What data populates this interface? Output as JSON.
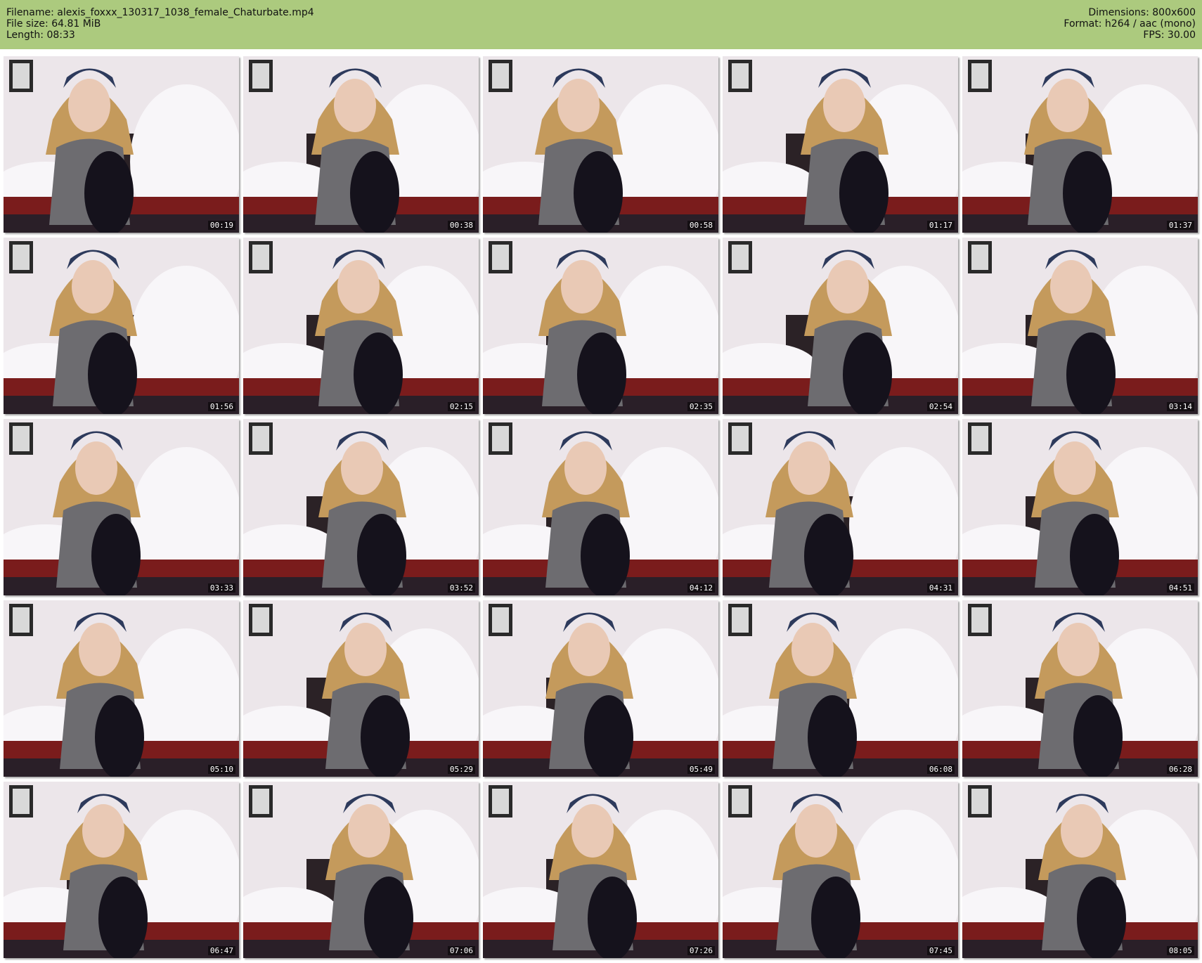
{
  "header": {
    "filename": "Filename: alexis_foxxx_130317_1038_female_Chaturbate.mp4",
    "filesize": "File size: 64.81 MiB",
    "length": "Length: 08:33",
    "dimensions": "Dimensions: 800x600",
    "format": "Format: h264 / aac (mono)",
    "fps": "FPS: 30.00"
  },
  "colors": {
    "header_bg": "#acca7e",
    "wall": "#ece6ea",
    "hair": "#c49a5c",
    "bandana": "#2d3a5c",
    "shirt": "#6d6c70",
    "pants": "#15121c",
    "bedspread": "#7a1c1c",
    "teddy": "#f8f6f9"
  },
  "thumbnails": [
    {
      "time": "00:19"
    },
    {
      "time": "00:38"
    },
    {
      "time": "00:58"
    },
    {
      "time": "01:17"
    },
    {
      "time": "01:37"
    },
    {
      "time": "01:56"
    },
    {
      "time": "02:15"
    },
    {
      "time": "02:35"
    },
    {
      "time": "02:54"
    },
    {
      "time": "03:14"
    },
    {
      "time": "03:33"
    },
    {
      "time": "03:52"
    },
    {
      "time": "04:12"
    },
    {
      "time": "04:31"
    },
    {
      "time": "04:51"
    },
    {
      "time": "05:10"
    },
    {
      "time": "05:29"
    },
    {
      "time": "05:49"
    },
    {
      "time": "06:08"
    },
    {
      "time": "06:28"
    },
    {
      "time": "06:47"
    },
    {
      "time": "07:06"
    },
    {
      "time": "07:26"
    },
    {
      "time": "07:45"
    },
    {
      "time": "08:05"
    }
  ]
}
